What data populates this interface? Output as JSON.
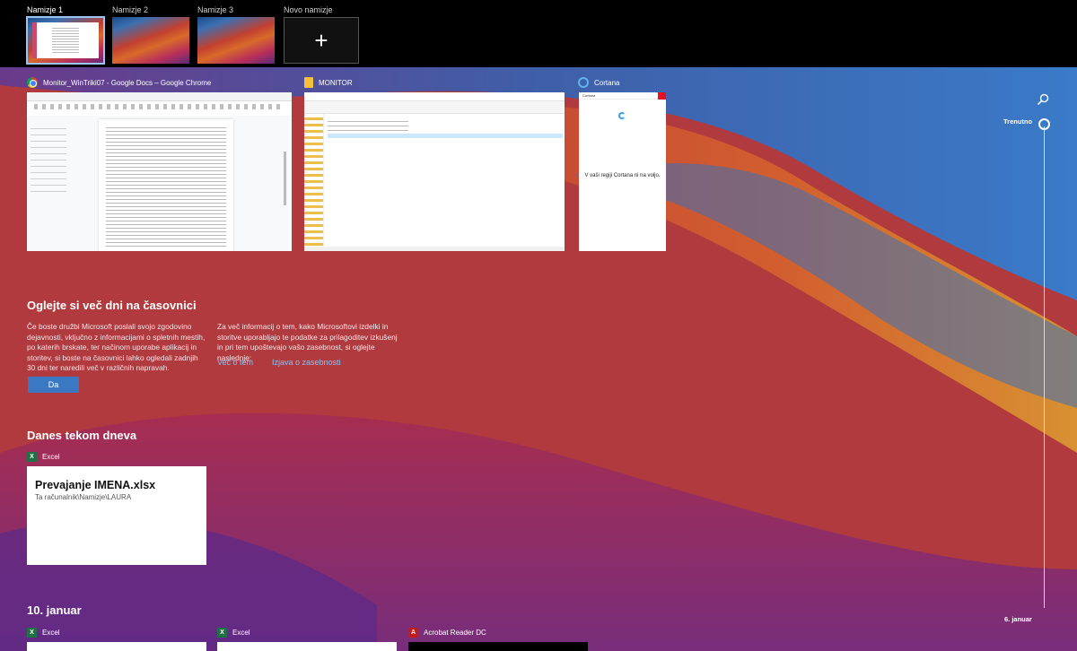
{
  "desktops": [
    {
      "label": "Namizje 1",
      "active": true
    },
    {
      "label": "Namizje 2",
      "active": false
    },
    {
      "label": "Namizje 3",
      "active": false
    }
  ],
  "new_desktop": {
    "label": "Novo namizje",
    "icon": "plus-icon"
  },
  "windows": [
    {
      "title": "Monitor_WinTriki07 - Google Docs – Google Chrome",
      "icon": "chrome-icon"
    },
    {
      "title": "MONITOR",
      "icon": "folder-icon"
    },
    {
      "title": "Cortana",
      "icon": "cortana-icon",
      "inner_title": "Cortana",
      "message": "V vaši regiji Cortana ni na voljo."
    }
  ],
  "timeline_promo": {
    "title": "Oglejte si več dni na časovnici",
    "left_text": "Če boste družbi Microsoft poslali svojo zgodovino dejavnosti, vključno z informacijami o spletnih mestih, po katerih brskate, ter načinom uporabe aplikacij in storitev, si boste na časovnici lahko ogledali zadnjih 30 dni ter naredili več v različnih napravah.",
    "right_text": "Za več informacij o tem, kako Microsoftovi izdelki in storitve uporabljajo te podatke za prilagoditev izkušenj in pri tem upoštevajo vašo zasebnost, si oglejte naslednje:",
    "yes_button": "Da",
    "link_more": "Več o tem",
    "link_privacy": "Izjava o zasebnosti"
  },
  "today": {
    "heading": "Danes tekom dneva",
    "app": "Excel",
    "card_title": "Prevajanje IMENA.xlsx",
    "card_path": "Ta računalnik\\Namizje\\LAURA"
  },
  "jan10": {
    "heading": "10. januar",
    "apps": [
      "Excel",
      "Excel",
      "Acrobat Reader DC"
    ]
  },
  "timeline": {
    "current_label": "Trenutno",
    "date_label": "6. januar"
  },
  "colors": {
    "accent": "#3b78c4",
    "link": "#8cc0f0"
  }
}
